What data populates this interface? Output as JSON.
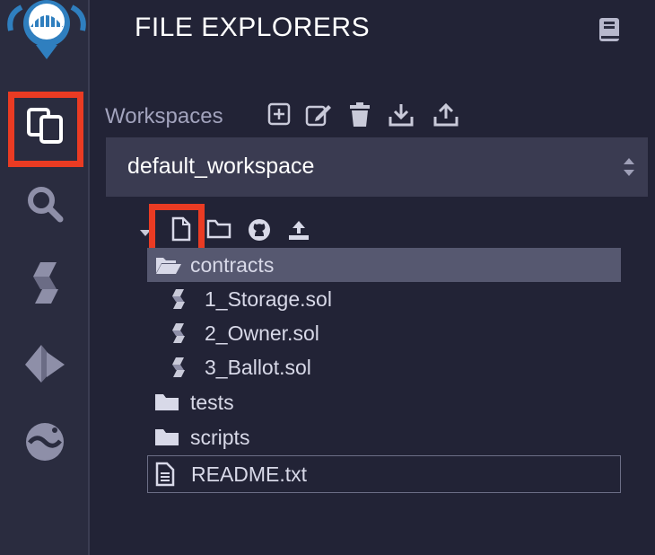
{
  "header": {
    "title": "FILE EXPLORERS",
    "docs_icon": "book-icon"
  },
  "sidebar": {
    "items": [
      {
        "name": "remix-logo",
        "icon": "remix-logo-icon"
      },
      {
        "name": "file-explorers",
        "icon": "files-icon",
        "active": true
      },
      {
        "name": "search",
        "icon": "search-icon"
      },
      {
        "name": "solidity-compiler",
        "icon": "solidity-icon"
      },
      {
        "name": "deploy-run",
        "icon": "ethereum-icon"
      },
      {
        "name": "debugger",
        "icon": "wave-icon"
      }
    ]
  },
  "workspaces": {
    "label": "Workspaces",
    "selected": "default_workspace",
    "actions": [
      "add-workspace-icon",
      "rename-workspace-icon",
      "delete-workspace-icon",
      "download-workspace-icon",
      "upload-workspace-icon"
    ]
  },
  "tree_actions": [
    "new-file-icon",
    "new-folder-icon",
    "github-icon",
    "upload-file-icon"
  ],
  "files": [
    {
      "name": "contracts",
      "type": "folder-open",
      "selected": true
    },
    {
      "name": "1_Storage.sol",
      "type": "solidity-file"
    },
    {
      "name": "2_Owner.sol",
      "type": "solidity-file"
    },
    {
      "name": "3_Ballot.sol",
      "type": "solidity-file"
    },
    {
      "name": "tests",
      "type": "folder"
    },
    {
      "name": "scripts",
      "type": "folder"
    },
    {
      "name": "README.txt",
      "type": "text-file"
    }
  ],
  "colors": {
    "accent_highlight": "#ea3b23",
    "background": "#222336",
    "rail": "#2a2c3f",
    "selected_row": "#565870"
  }
}
